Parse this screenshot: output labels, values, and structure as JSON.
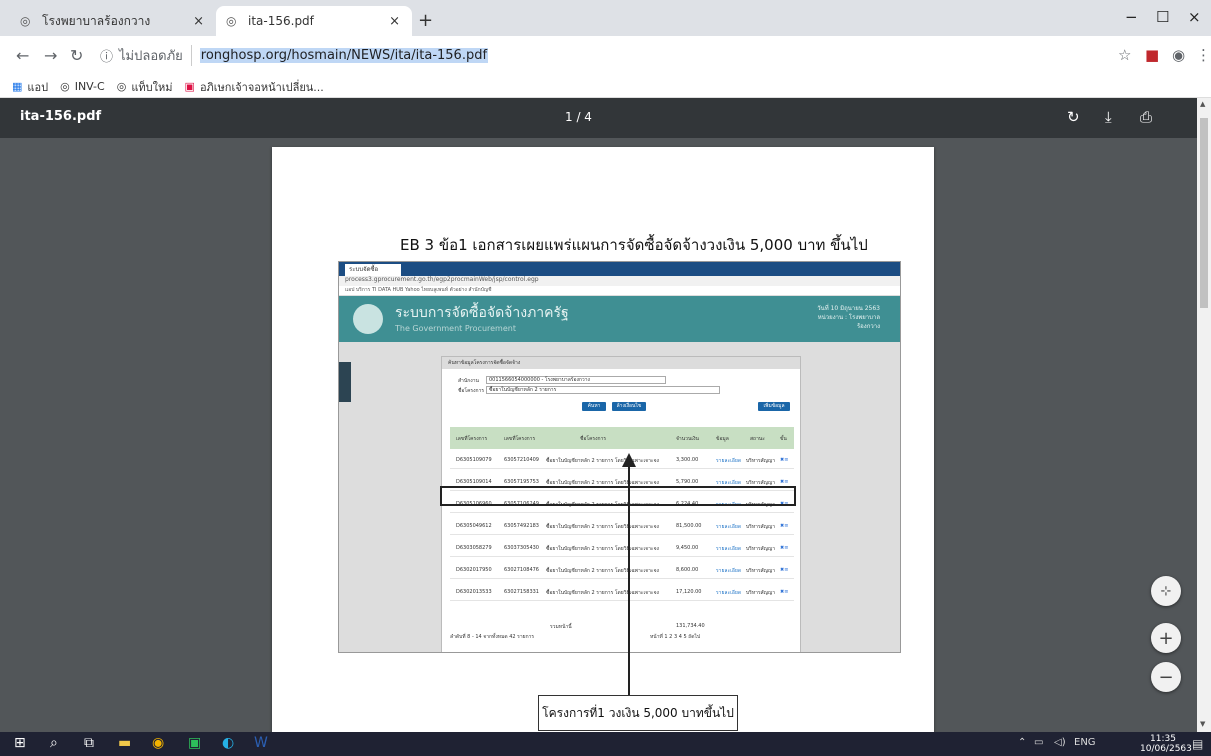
{
  "browser": {
    "tabs": [
      {
        "label": "โรงพยาบาลร้องกวาง",
        "close": "×"
      },
      {
        "label": "ita-156.pdf",
        "close": "×"
      }
    ],
    "new_tab": "+",
    "window": {
      "minimize": "−",
      "maximize": "☐",
      "close": "×"
    },
    "security_label": "ไม่ปลอดภัย",
    "url": "ronghosp.org/hosmain/NEWS/ita/ita-156.pdf",
    "bookmarks": [
      "แอป",
      "INV-C",
      "แท็บใหม่",
      "อภิเษกเจ้าจอหน้าเปลี่ยน..."
    ]
  },
  "pdf": {
    "filename": "ita-156.pdf",
    "page_indicator": "1 / 4",
    "title": "EB 3 ข้อ1 เอกสารเผยแพร่แผนการจัดซื้อจัดจ้างวงเงิน 5,000 บาท ขึ้นไป",
    "callout": "โครงการที่1 วงเงิน 5,000 บาทขึ้นไป",
    "inner": {
      "tab": "ระบบจัดซื้อ",
      "address": "process3.gprocurement.go.th/egp2procmainWeb/jsp/control.egp",
      "bookmarks": "แอป  บริการ  TI DATA HUB  Yahoo  ไทยบลูเพนท์  ตัวอย่าง  สำนักบัญชี",
      "header_title": "ระบบการจัดซื้อจัดจ้างภาครัฐ",
      "header_sub": "The Government Procurement",
      "header_right": "วันที่ 10 มิถุนายน 2563 หน่วยงาน : โรงพยาบาลร้องกวาง",
      "panel_head": "ค้นหาข้อมูลโครงการจัดซื้อจัดจ้าง",
      "form": {
        "dept_label": "สำนักงาน",
        "dept_value": "0011566054000000 - โรงพยาบาลร้องกวาง",
        "project_label": "ชื่อโครงการ",
        "project_value": "ซื้อยาในบัญชียาหลัก 2 รายการ"
      },
      "buttons": {
        "search": "ค้นหา",
        "clear": "ล้างเงื่อนไข",
        "add": "เพิ่มข้อมูล"
      },
      "columns": [
        "เลขที่โครงการ",
        "เลขที่โครงการ",
        "ชื่อโครงการ",
        "จำนวนเงิน",
        "ข้อมูล",
        "สถานะ",
        "ขั้น"
      ],
      "rows": [
        {
          "id": "D6305109079",
          "no": "63057210409",
          "name": "ซื้อยาในบัญชียาหลัก 2 รายการ โดยวิธีเฉพาะเจาะจง",
          "amount": "3,300.00",
          "info": "รายละเอียด",
          "status": "บริหารสัญญา"
        },
        {
          "id": "D6305109014",
          "no": "63057195753",
          "name": "ซื้อยาในบัญชียาหลัก 2 รายการ โดยวิธีเฉพาะเจาะจง",
          "amount": "5,790.00",
          "info": "รายละเอียด",
          "status": "บริหารสัญญา"
        },
        {
          "id": "D6305106960",
          "no": "63057106249",
          "name": "ซื้อยาในบัญชียาหลัก 2 รายการ โดยวิธีเฉพาะเจาะจง",
          "amount": "6,224.40",
          "info": "รายละเอียด",
          "status": "บริหารสัญญา"
        },
        {
          "id": "D6305049612",
          "no": "63057492183",
          "name": "ซื้อยาในบัญชียาหลัก 2 รายการ โดยวิธีเฉพาะเจาะจง",
          "amount": "81,500.00",
          "info": "รายละเอียด",
          "status": "บริหารสัญญา"
        },
        {
          "id": "D6303058279",
          "no": "63037305430",
          "name": "ซื้อยาในบัญชียาหลัก 2 รายการ โดยวิธีเฉพาะเจาะจง",
          "amount": "9,450.00",
          "info": "รายละเอียด",
          "status": "บริหารสัญญา"
        },
        {
          "id": "D6302017950",
          "no": "63027108476",
          "name": "ซื้อยาในบัญชียาหลัก 2 รายการ โดยวิธีเฉพาะเจาะจง",
          "amount": "8,600.00",
          "info": "รายละเอียด",
          "status": "บริหารสัญญา"
        },
        {
          "id": "D6302013533",
          "no": "63027158331",
          "name": "ซื้อยาในบัญชียาหลัก 2 รายการ โดยวิธีเฉพาะเจาะจง",
          "amount": "17,120.00",
          "info": "รายละเอียด",
          "status": "บริหารสัญญา"
        }
      ],
      "total_label": "รวมหน้านี้",
      "total_value": "131,734.40",
      "footer": "ลำดับที่ 8 - 14 จากทั้งหมด 42 รายการ",
      "pager": "หน้าที่   1   2   3   4   5   ถัดไป"
    }
  },
  "taskbar": {
    "time": "11:35",
    "date": "10/06/2563",
    "lang": "ENG"
  }
}
